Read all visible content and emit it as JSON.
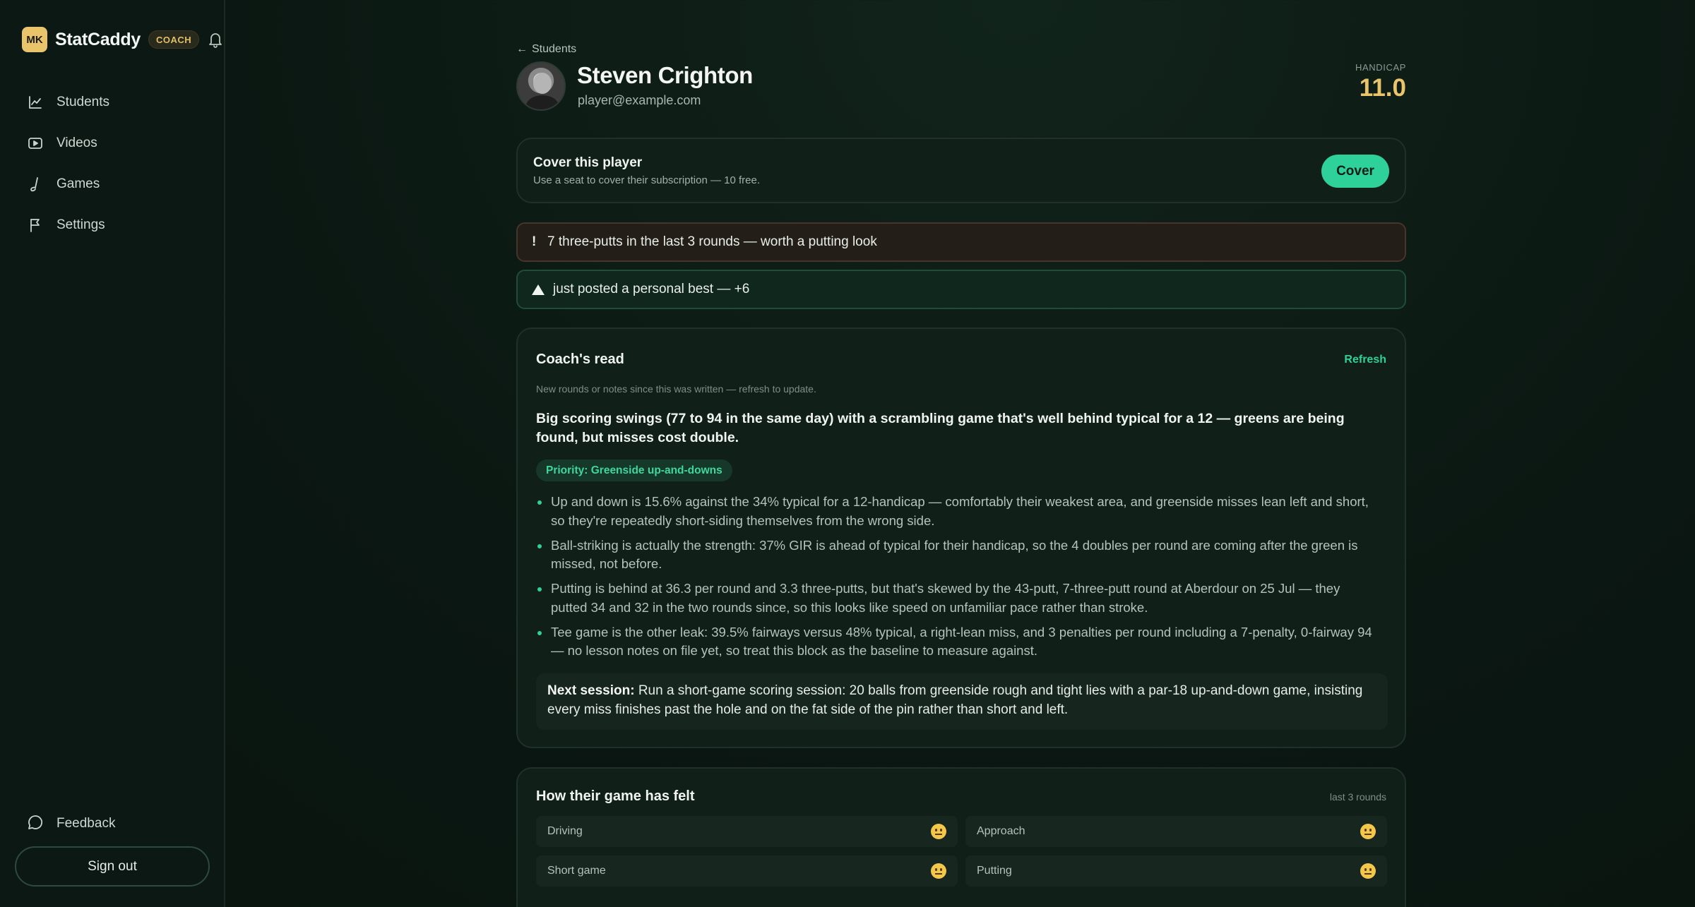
{
  "sidebar": {
    "logo_initials": "MK",
    "app_name": "StatCaddy",
    "role_badge": "COACH",
    "items": [
      {
        "label": "Students",
        "icon": "chart-line-icon"
      },
      {
        "label": "Videos",
        "icon": "video-icon"
      },
      {
        "label": "Games",
        "icon": "golf-club-icon"
      },
      {
        "label": "Settings",
        "icon": "flag-icon"
      }
    ],
    "feedback_label": "Feedback",
    "signout_label": "Sign out"
  },
  "header": {
    "back_label": "Students",
    "player_name": "Steven Crighton",
    "player_email": "player@example.com",
    "handicap_label": "HANDICAP",
    "handicap_value": "11.0"
  },
  "cover": {
    "title": "Cover this player",
    "subtitle": "Use a seat to cover their subscription — 10 free.",
    "button": "Cover"
  },
  "alerts": {
    "warning_mark": "!",
    "warning": "7 three-putts in the last 3 rounds — worth a putting look",
    "good": "just posted a personal best — +6"
  },
  "coach_read": {
    "title": "Coach's read",
    "refresh": "Refresh",
    "stale_note": "New rounds or notes since this was written — refresh to update.",
    "headline": "Big scoring swings (77 to 94 in the same day) with a scrambling game that's well behind typical for a 12 — greens are being found, but misses cost double.",
    "priority": "Priority: Greenside up-and-downs",
    "bullets": [
      "Up and down is 15.6% against the 34% typical for a 12-handicap — comfortably their weakest area, and greenside misses lean left and short, so they're repeatedly short-siding themselves from the wrong side.",
      "Ball-striking is actually the strength: 37% GIR is ahead of typical for their handicap, so the 4 doubles per round are coming after the green is missed, not before.",
      "Putting is behind at 36.3 per round and 3.3 three-putts, but that's skewed by the 43-putt, 7-three-putt round at Aberdour on 25 Jul — they putted 34 and 32 in the two rounds since, so this looks like speed on unfamiliar pace rather than stroke.",
      "Tee game is the other leak: 39.5% fairways versus 48% typical, a right-lean miss, and 3 penalties per round including a 7-penalty, 0-fairway 94 — no lesson notes on file yet, so treat this block as the baseline to measure against."
    ],
    "next_label": "Next session:",
    "next_text": " Run a short-game scoring session: 20 balls from greenside rough and tight lies with a par-18 up-and-down game, insisting every miss finishes past the hole and on the fat side of the pin rather than short and left."
  },
  "felt": {
    "title": "How their game has felt",
    "meta": "last 3 rounds",
    "tiles": [
      {
        "label": "Driving",
        "mood": "neutral-face-icon"
      },
      {
        "label": "Approach",
        "mood": "neutral-face-icon"
      },
      {
        "label": "Short game",
        "mood": "neutral-face-icon"
      },
      {
        "label": "Putting",
        "mood": "neutral-face-icon"
      }
    ]
  },
  "colors": {
    "accent": "#2fd19a",
    "gold": "#e9c46a",
    "background": "#0b1712"
  }
}
